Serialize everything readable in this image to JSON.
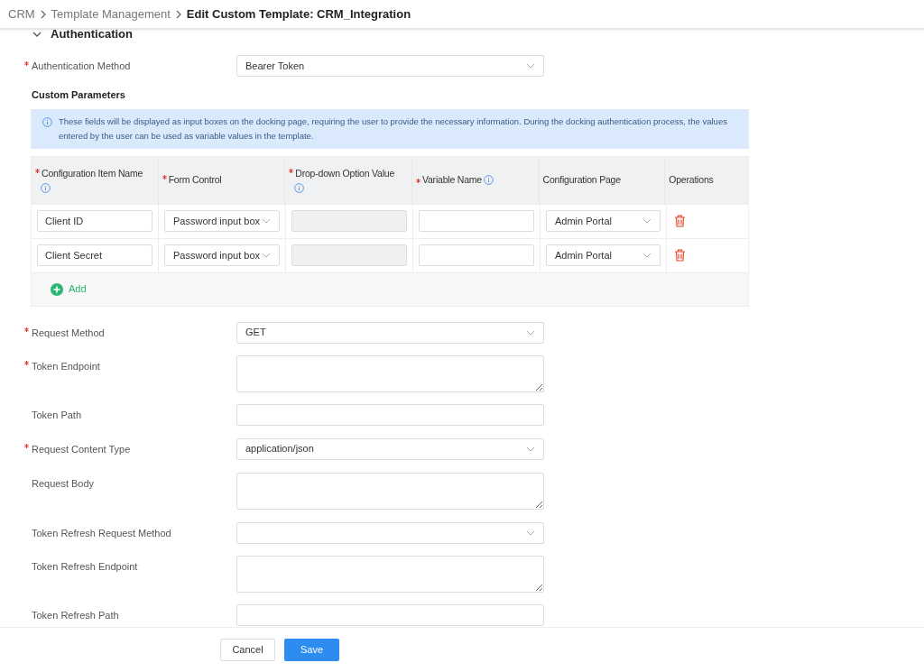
{
  "breadcrumb": [
    {
      "label": "CRM",
      "current": false
    },
    {
      "label": "Template Management",
      "current": false
    },
    {
      "label": "Edit Custom Template: CRM_Integration",
      "current": true
    }
  ],
  "section": {
    "title": "Authentication",
    "expanded": true
  },
  "auth_field": {
    "kind": "select",
    "label": "Authentication Method",
    "required": true,
    "value": "Bearer Token"
  },
  "custom_parameters": {
    "title": "Custom Parameters",
    "info": "These fields will be displayed as input boxes on the docking page, requiring the user to provide the necessary information. During the docking authentication process, the values entered by the user can be used as variable values in the template.",
    "columns": [
      {
        "label": "Configuration Item Name",
        "required": true,
        "info": true
      },
      {
        "label": "Form Control",
        "required": true,
        "info": false
      },
      {
        "label": "Drop-down Option Value",
        "required": true,
        "info": true
      },
      {
        "label": "Variable Name",
        "required": true,
        "info": true
      },
      {
        "label": "Configuration Page",
        "required": false,
        "info": false
      },
      {
        "label": "Operations",
        "required": false,
        "info": false
      }
    ],
    "rows": [
      {
        "name": "Client ID",
        "form_control": "Password input box",
        "option_disabled": true,
        "configuration_page": "Admin Portal"
      },
      {
        "name": "Client Secret",
        "form_control": "Password input box",
        "option_disabled": true,
        "configuration_page": "Admin Portal"
      }
    ],
    "add_label": "Add"
  },
  "fields": [
    {
      "kind": "select",
      "label": "Request Method",
      "required": true,
      "value": "GET"
    },
    {
      "kind": "textarea",
      "label": "Token Endpoint",
      "required": true
    },
    {
      "kind": "input",
      "label": "Token Path",
      "required": false
    },
    {
      "kind": "select",
      "label": "Request Content Type",
      "required": true,
      "value": "application/json"
    },
    {
      "kind": "textarea",
      "label": "Request Body",
      "required": false
    },
    {
      "kind": "select",
      "label": "Token Refresh Request Method",
      "required": false
    },
    {
      "kind": "textarea",
      "label": "Token Refresh Endpoint",
      "required": false
    },
    {
      "kind": "input",
      "label": "Token Refresh Path",
      "required": false
    }
  ],
  "buttons": [
    {
      "label": "Cancel",
      "kind": "secondary"
    },
    {
      "label": "Save",
      "kind": "primary"
    }
  ]
}
